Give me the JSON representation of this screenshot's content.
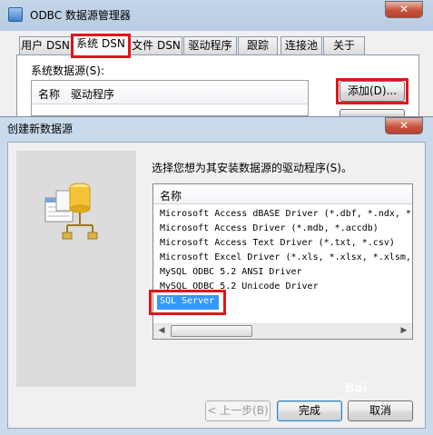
{
  "manager_window": {
    "title": "ODBC 数据源管理器",
    "close_glyph": "✕",
    "tabs": [
      {
        "label": "用户 DSN"
      },
      {
        "label": "系统 DSN",
        "active": true
      },
      {
        "label": "文件 DSN"
      },
      {
        "label": "驱动程序"
      },
      {
        "label": "跟踪"
      },
      {
        "label": "连接池"
      },
      {
        "label": "关于"
      }
    ],
    "group_label": "系统数据源(S):",
    "columns": {
      "name": "名称",
      "driver": "驱动程序"
    },
    "add_button": "添加(D)..."
  },
  "create_dialog": {
    "title": "创建新数据源",
    "close_glyph": "✕",
    "prompt": "选择您想为其安装数据源的驱动程序(S)。",
    "list_header": "名称",
    "drivers": [
      "Microsoft Access dBASE Driver (*.dbf, *.ndx, *",
      "Microsoft Access Driver (*.mdb, *.accdb)",
      "Microsoft Access Text Driver (*.txt, *.csv)",
      "Microsoft Excel Driver (*.xls, *.xlsx, *.xlsm,",
      "MySQL ODBC 5.2 ANSI Driver",
      "MySQL ODBC 5.2 Unicode Driver",
      "SQL Server"
    ],
    "selected_driver": "SQL Server",
    "scroll_left_glyph": "◀",
    "scroll_right_glyph": "▶",
    "back_button": "< 上一步(B)",
    "finish_button": "完成",
    "cancel_button": "取消"
  },
  "watermark": "Bai"
}
